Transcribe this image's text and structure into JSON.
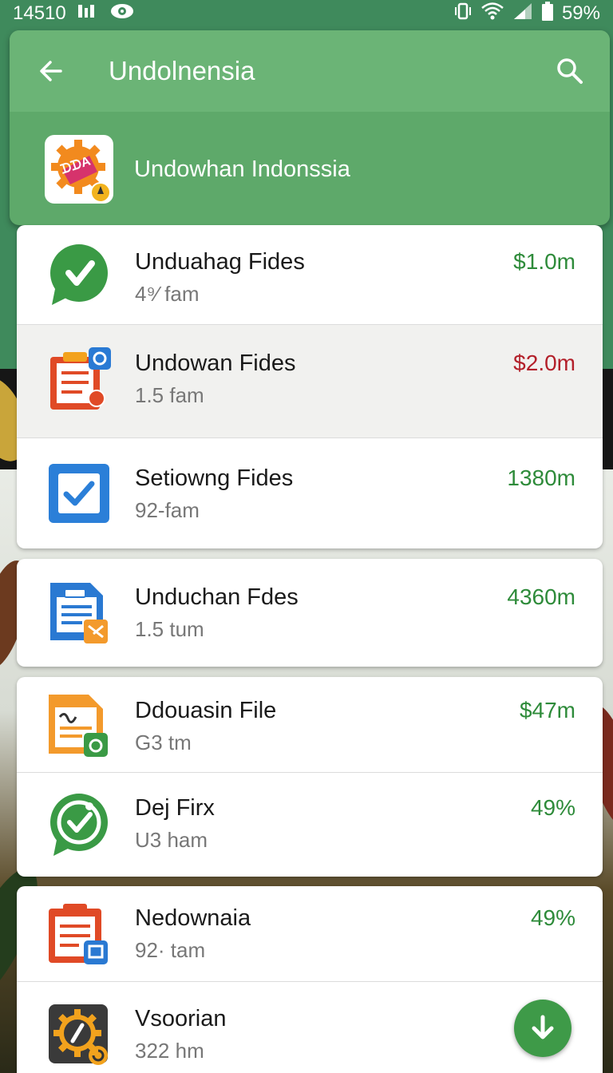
{
  "status_bar": {
    "time": "14510",
    "battery": "59%"
  },
  "app_bar": {
    "title": "Undolnensia",
    "back_icon": "arrow-left-icon",
    "search_icon": "search-icon"
  },
  "header": {
    "subtitle": "Undowhan Indonssia",
    "logo_text": "ᗪᗪA",
    "logo_icon": "gear-badge-icon"
  },
  "colors": {
    "primary": "#6bb476",
    "positive": "#2e8b3a",
    "negative": "#b3202a",
    "fab": "#3e9a48"
  },
  "items": [
    {
      "title": "Unduahag Fides",
      "subtitle": "4⁹⁄ fam",
      "value": "$1.0m",
      "value_color": "green",
      "icon": "check-chat-icon"
    },
    {
      "title": "Undowan Fides",
      "subtitle": "1.5 fam",
      "value": "$2.0m",
      "value_color": "red",
      "icon": "clipboard-doc-icon"
    },
    {
      "title": "Setiowng Fides",
      "subtitle": "92-fam",
      "value": "1380m",
      "value_color": "green",
      "icon": "checkbox-icon"
    },
    {
      "title": "Unduchan Fdes",
      "subtitle": "1.5 tum",
      "value": "4360m",
      "value_color": "green",
      "icon": "document-list-icon"
    },
    {
      "title": "Ddouasin File",
      "subtitle": "G3 tm",
      "value": "$47m",
      "value_color": "green",
      "icon": "document-sign-icon"
    },
    {
      "title": "Dej Firx",
      "subtitle": "U3 ham",
      "value": "49%",
      "value_color": "green",
      "icon": "check-circle-icon"
    },
    {
      "title": "Nedownaia",
      "subtitle": "92· tam",
      "value": "49%",
      "value_color": "green",
      "icon": "clipboard-save-icon"
    },
    {
      "title": "Vsoorian",
      "subtitle": "322 hm",
      "value": "",
      "value_color": "green",
      "icon": "gear-refresh-icon"
    }
  ],
  "fab": {
    "icon": "download-arrow-icon"
  }
}
